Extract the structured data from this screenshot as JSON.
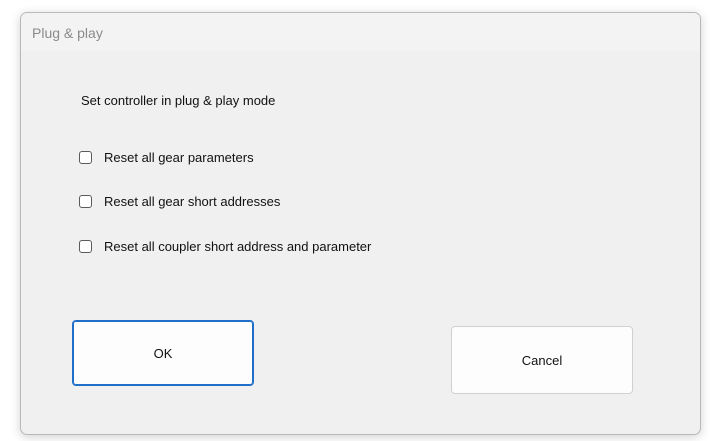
{
  "dialog": {
    "title": "Plug & play",
    "instruction": "Set controller in plug & play mode",
    "options": [
      {
        "label": "Reset all gear parameters",
        "checked": false
      },
      {
        "label": "Reset all gear short addresses",
        "checked": false
      },
      {
        "label": "Reset all coupler short address and parameter",
        "checked": false
      }
    ],
    "ok_label": "OK",
    "cancel_label": "Cancel"
  },
  "colors": {
    "dialog_background": "#f0f0f0",
    "default_button_border": "#1f6fc9",
    "title_text": "#8a8a8a"
  }
}
